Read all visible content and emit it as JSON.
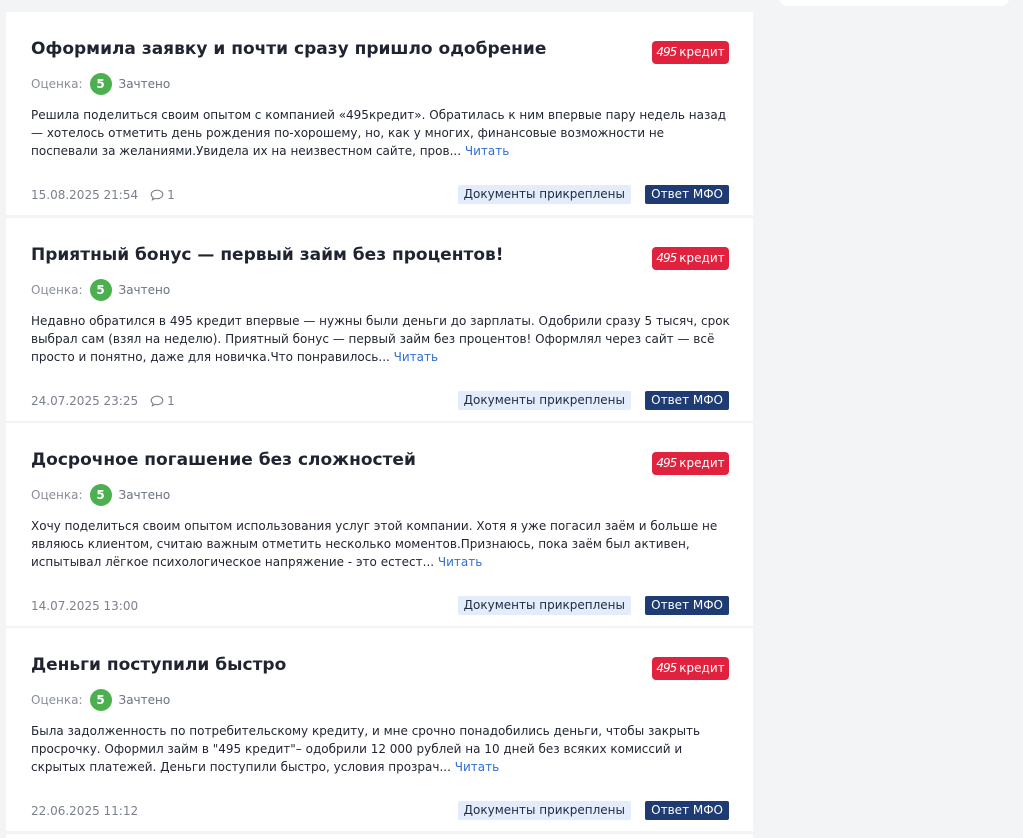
{
  "reviews": [
    {
      "title": "Оформила заявку и почти сразу пришло одобрение",
      "brand_num": "495",
      "brand_word": "кредит",
      "rating_label": "Оценка:",
      "rating_value": "5",
      "rating_status": "Зачтено",
      "text": "Решила поделиться своим опытом с компанией «495кредит». Обратилась к ним впервые пару недель назад — хотелось отметить день рождения по-хорошему, но, как у многих, финансовые возможности не поспевали за желаниями.Увидела их на неизвестном сайте, пров... ",
      "read_more": "Читать",
      "date": "15.08.2025 21:54",
      "comments": "1",
      "tag_docs": "Документы прикреплены",
      "tag_mfo": "Ответ МФО"
    },
    {
      "title": "Приятный бонус — первый займ без процентов!",
      "brand_num": "495",
      "brand_word": "кредит",
      "rating_label": "Оценка:",
      "rating_value": "5",
      "rating_status": "Зачтено",
      "text": "Недавно обратился в 495 кредит впервые — нужны были деньги до зарплаты. Одобрили сразу 5 тысяч, срок выбрал сам (взял на неделю). Приятный бонус — первый займ без процентов! Оформлял через сайт — всё просто и понятно, даже для новичка.Что понравилось... ",
      "read_more": "Читать",
      "date": "24.07.2025 23:25",
      "comments": "1",
      "tag_docs": "Документы прикреплены",
      "tag_mfo": "Ответ МФО"
    },
    {
      "title": "Досрочное погашение без сложностей",
      "brand_num": "495",
      "brand_word": "кредит",
      "rating_label": "Оценка:",
      "rating_value": "5",
      "rating_status": "Зачтено",
      "text": "Хочу поделиться своим опытом использования услуг этой компании. Хотя я уже погасил заём и больше не являюсь клиентом, считаю важным отметить несколько моментов.Признаюсь, пока заём был активен, испытывал лёгкое психологическое напряжение - это естест... ",
      "read_more": "Читать",
      "date": "14.07.2025 13:00",
      "tag_docs": "Документы прикреплены",
      "tag_mfo": "Ответ МФО"
    },
    {
      "title": "Деньги поступили быстро",
      "brand_num": "495",
      "brand_word": "кредит",
      "rating_label": "Оценка:",
      "rating_value": "5",
      "rating_status": "Зачтено",
      "text": "Была задолженность по потребительскому кредиту, и мне срочно понадобились деньги, чтобы закрыть просрочку. Оформил займ в \"495 кредит\"– одобрили 12 000 рублей на 10 дней без всяких комиссий и скрытых платежей. Деньги поступили быстро, условия прозрач... ",
      "read_more": "Читать",
      "date": "22.06.2025 11:12",
      "tag_docs": "Документы прикреплены",
      "tag_mfo": "Ответ МФО"
    }
  ],
  "colors": {
    "brand_red": "#e0223f",
    "rating_green": "#4caf50",
    "link_blue": "#2f6fd6",
    "mfo_navy": "#1f3b73",
    "docs_bg": "#e3ecfa"
  }
}
